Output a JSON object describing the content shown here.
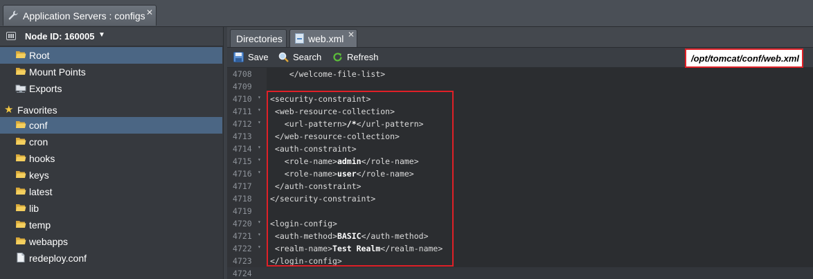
{
  "window": {
    "title": "Application Servers : configs",
    "close": "✕"
  },
  "node": {
    "label": "Node ID: 160005",
    "caret": "▼"
  },
  "tree": {
    "items": [
      {
        "label": "Root",
        "icon": "folder-open-icon",
        "selected": true
      },
      {
        "label": "Mount Points",
        "icon": "folder-icon"
      },
      {
        "label": "Exports",
        "icon": "network-folder-icon"
      }
    ],
    "favorites_label": "Favorites",
    "favorites": [
      {
        "label": "conf",
        "icon": "folder-open-icon",
        "selected": true
      },
      {
        "label": "cron",
        "icon": "folder-icon"
      },
      {
        "label": "hooks",
        "icon": "folder-icon"
      },
      {
        "label": "keys",
        "icon": "folder-icon"
      },
      {
        "label": "latest",
        "icon": "folder-icon"
      },
      {
        "label": "lib",
        "icon": "folder-icon"
      },
      {
        "label": "temp",
        "icon": "folder-icon"
      },
      {
        "label": "webapps",
        "icon": "folder-icon"
      },
      {
        "label": "redeploy.conf",
        "icon": "file-icon"
      }
    ]
  },
  "tabs": {
    "directories": "Directories",
    "file": "web.xml",
    "close": "✕"
  },
  "toolbar": {
    "save": "Save",
    "search": "Search",
    "refresh": "Refresh",
    "path": "/opt/tomcat/conf/web.xml"
  },
  "editor": {
    "lines": [
      {
        "n": "4708",
        "fold": "",
        "pre": "    </welcome-file-list>",
        "val": "",
        "post": ""
      },
      {
        "n": "4709",
        "fold": "",
        "pre": "",
        "val": "",
        "post": ""
      },
      {
        "n": "4710",
        "fold": "▾",
        "pre": "<security-constraint>",
        "val": "",
        "post": ""
      },
      {
        "n": "4711",
        "fold": "▾",
        "pre": " <web-resource-collection>",
        "val": "",
        "post": ""
      },
      {
        "n": "4712",
        "fold": "▾",
        "pre": "   <url-pattern>",
        "val": "/*",
        "post": "</url-pattern>"
      },
      {
        "n": "4713",
        "fold": "",
        "pre": " </web-resource-collection>",
        "val": "",
        "post": ""
      },
      {
        "n": "4714",
        "fold": "▾",
        "pre": " <auth-constraint>",
        "val": "",
        "post": ""
      },
      {
        "n": "4715",
        "fold": "▾",
        "pre": "   <role-name>",
        "val": "admin",
        "post": "</role-name>"
      },
      {
        "n": "4716",
        "fold": "▾",
        "pre": "   <role-name>",
        "val": "user",
        "post": "</role-name>"
      },
      {
        "n": "4717",
        "fold": "",
        "pre": " </auth-constraint>",
        "val": "",
        "post": ""
      },
      {
        "n": "4718",
        "fold": "",
        "pre": "</security-constraint>",
        "val": "",
        "post": ""
      },
      {
        "n": "4719",
        "fold": "",
        "pre": "",
        "val": "",
        "post": ""
      },
      {
        "n": "4720",
        "fold": "▾",
        "pre": "<login-config>",
        "val": "",
        "post": ""
      },
      {
        "n": "4721",
        "fold": "▾",
        "pre": " <auth-method>",
        "val": "BASIC",
        "post": "</auth-method>"
      },
      {
        "n": "4722",
        "fold": "▾",
        "pre": " <realm-name>",
        "val": "Test Realm",
        "post": "</realm-name>"
      },
      {
        "n": "4723",
        "fold": "",
        "pre": "</login-config>",
        "val": "",
        "post": ""
      },
      {
        "n": "4724",
        "fold": "",
        "pre": "",
        "val": "",
        "post": "",
        "active": true
      }
    ]
  },
  "colors": {
    "highlight": "#e02027",
    "selection": "#4b6684",
    "folder": "#f0c24b"
  }
}
